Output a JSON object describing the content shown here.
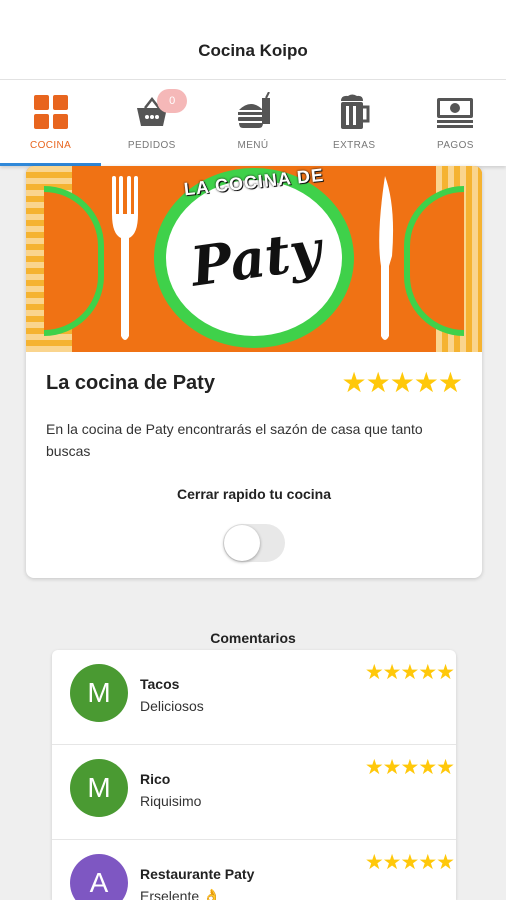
{
  "header": {
    "title": "Cocina Koipo"
  },
  "tabs": [
    {
      "label": "COCINA",
      "icon": "grid-icon",
      "active": true
    },
    {
      "label": "PEDIDOS",
      "icon": "basket-icon",
      "badge": "0"
    },
    {
      "label": "MENÚ",
      "icon": "burger-drink-icon"
    },
    {
      "label": "EXTRAS",
      "icon": "beer-mug-icon"
    },
    {
      "label": "PAGOS",
      "icon": "money-icon"
    }
  ],
  "restaurant": {
    "banner_top_text": "LA COCINA DE",
    "banner_script": "Paty",
    "name": "La cocina de Paty",
    "rating": 5,
    "stars": "★★★★★",
    "description": "En la cocina de Paty encontrarás el sazón de casa que tanto buscas",
    "quick_close_label": "Cerrar rapido tu cocina",
    "quick_close_on": false
  },
  "comments": {
    "title": "Comentarios",
    "items": [
      {
        "initial": "M",
        "avatar_color": "#4a9a32",
        "name": "Tacos",
        "text": "Deliciosos",
        "stars": "★★★★★"
      },
      {
        "initial": "M",
        "avatar_color": "#4a9a32",
        "name": "Rico",
        "text": "Riquisimo",
        "stars": "★★★★★"
      },
      {
        "initial": "A",
        "avatar_color": "#7e57c2",
        "name": "Restaurante Paty",
        "text": "Erselente 👌",
        "stars": "★★★★★"
      }
    ]
  },
  "colors": {
    "accent": "#e8651e",
    "indicator": "#2f88d9",
    "star": "#ffc80a",
    "banner_green": "#3fd14a"
  }
}
